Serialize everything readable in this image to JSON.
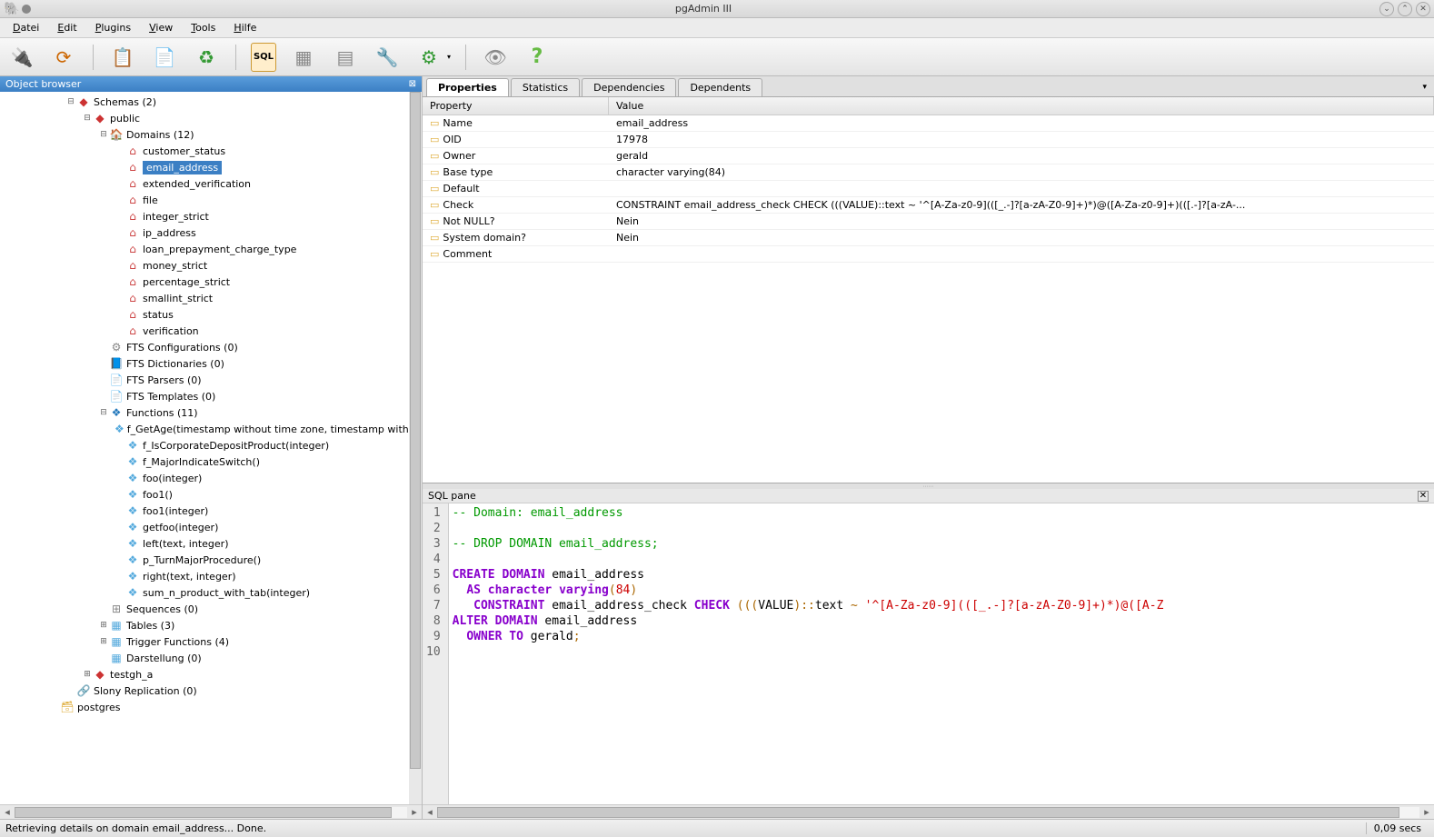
{
  "window": {
    "title": "pgAdmin III"
  },
  "menubar": [
    {
      "label": "Datei",
      "u": "D"
    },
    {
      "label": "Edit",
      "u": "E"
    },
    {
      "label": "Plugins",
      "u": "P"
    },
    {
      "label": "View",
      "u": "V"
    },
    {
      "label": "Tools",
      "u": "T"
    },
    {
      "label": "Hilfe",
      "u": "H"
    }
  ],
  "object_browser": {
    "title": "Object browser"
  },
  "tree": [
    {
      "depth": 4,
      "exp": "minus",
      "icon": "schema",
      "label": "Schemas (2)"
    },
    {
      "depth": 5,
      "exp": "minus",
      "icon": "public",
      "label": "public"
    },
    {
      "depth": 6,
      "exp": "minus",
      "icon": "domains",
      "label": "Domains (12)"
    },
    {
      "depth": 7,
      "exp": "",
      "icon": "domain",
      "label": "customer_status"
    },
    {
      "depth": 7,
      "exp": "",
      "icon": "domain",
      "label": "email_address",
      "selected": true
    },
    {
      "depth": 7,
      "exp": "",
      "icon": "domain",
      "label": "extended_verification"
    },
    {
      "depth": 7,
      "exp": "",
      "icon": "domain",
      "label": "file"
    },
    {
      "depth": 7,
      "exp": "",
      "icon": "domain",
      "label": "integer_strict"
    },
    {
      "depth": 7,
      "exp": "",
      "icon": "domain",
      "label": "ip_address"
    },
    {
      "depth": 7,
      "exp": "",
      "icon": "domain",
      "label": "loan_prepayment_charge_type"
    },
    {
      "depth": 7,
      "exp": "",
      "icon": "domain",
      "label": "money_strict"
    },
    {
      "depth": 7,
      "exp": "",
      "icon": "domain",
      "label": "percentage_strict"
    },
    {
      "depth": 7,
      "exp": "",
      "icon": "domain",
      "label": "smallint_strict"
    },
    {
      "depth": 7,
      "exp": "",
      "icon": "domain",
      "label": "status"
    },
    {
      "depth": 7,
      "exp": "",
      "icon": "domain",
      "label": "verification"
    },
    {
      "depth": 6,
      "exp": "",
      "icon": "fts",
      "label": "FTS Configurations (0)"
    },
    {
      "depth": 6,
      "exp": "",
      "icon": "dict",
      "label": "FTS Dictionaries (0)"
    },
    {
      "depth": 6,
      "exp": "",
      "icon": "parser",
      "label": "FTS Parsers (0)"
    },
    {
      "depth": 6,
      "exp": "",
      "icon": "template",
      "label": "FTS Templates (0)"
    },
    {
      "depth": 6,
      "exp": "minus",
      "icon": "func",
      "label": "Functions (11)"
    },
    {
      "depth": 7,
      "exp": "",
      "icon": "funcitem",
      "label": "f_GetAge(timestamp without time zone, timestamp without"
    },
    {
      "depth": 7,
      "exp": "",
      "icon": "funcitem",
      "label": "f_IsCorporateDepositProduct(integer)"
    },
    {
      "depth": 7,
      "exp": "",
      "icon": "funcitem",
      "label": "f_MajorIndicateSwitch()"
    },
    {
      "depth": 7,
      "exp": "",
      "icon": "funcitem",
      "label": "foo(integer)"
    },
    {
      "depth": 7,
      "exp": "",
      "icon": "funcitem",
      "label": "foo1()"
    },
    {
      "depth": 7,
      "exp": "",
      "icon": "funcitem",
      "label": "foo1(integer)"
    },
    {
      "depth": 7,
      "exp": "",
      "icon": "funcitem",
      "label": "getfoo(integer)"
    },
    {
      "depth": 7,
      "exp": "",
      "icon": "funcitem",
      "label": "left(text, integer)"
    },
    {
      "depth": 7,
      "exp": "",
      "icon": "funcitem",
      "label": "p_TurnMajorProcedure()"
    },
    {
      "depth": 7,
      "exp": "",
      "icon": "funcitem",
      "label": "right(text, integer)"
    },
    {
      "depth": 7,
      "exp": "",
      "icon": "funcitem",
      "label": "sum_n_product_with_tab(integer)"
    },
    {
      "depth": 6,
      "exp": "",
      "icon": "seq",
      "label": "Sequences (0)"
    },
    {
      "depth": 6,
      "exp": "plus",
      "icon": "table",
      "label": "Tables (3)"
    },
    {
      "depth": 6,
      "exp": "plus",
      "icon": "trigger",
      "label": "Trigger Functions (4)"
    },
    {
      "depth": 6,
      "exp": "",
      "icon": "darst",
      "label": "Darstellung (0)"
    },
    {
      "depth": 5,
      "exp": "plus",
      "icon": "testgh",
      "label": "testgh_a"
    },
    {
      "depth": 4,
      "exp": "",
      "icon": "slony",
      "label": "Slony Replication (0)"
    },
    {
      "depth": 3,
      "exp": "",
      "icon": "db",
      "label": "postgres"
    }
  ],
  "tabs": [
    {
      "label": "Properties",
      "active": true
    },
    {
      "label": "Statistics",
      "active": false
    },
    {
      "label": "Dependencies",
      "active": false
    },
    {
      "label": "Dependents",
      "active": false
    }
  ],
  "prop_header": {
    "col1": "Property",
    "col2": "Value"
  },
  "properties": [
    {
      "k": "Name",
      "v": "email_address"
    },
    {
      "k": "OID",
      "v": "17978"
    },
    {
      "k": "Owner",
      "v": "gerald"
    },
    {
      "k": "Base type",
      "v": "character varying(84)"
    },
    {
      "k": "Default",
      "v": ""
    },
    {
      "k": "Check",
      "v": "CONSTRAINT email_address_check CHECK (((VALUE)::text ~ '^[A-Za-z0-9](([_.-]?[a-zA-Z0-9]+)*)@([A-Za-z0-9]+)(([.-]?[a-zA-..."
    },
    {
      "k": "Not NULL?",
      "v": "Nein"
    },
    {
      "k": "System domain?",
      "v": "Nein"
    },
    {
      "k": "Comment",
      "v": ""
    }
  ],
  "sql_pane": {
    "title": "SQL pane"
  },
  "sql_lines": [
    {
      "n": 1,
      "html": "<span class='c-comment'>-- Domain: email_address</span>"
    },
    {
      "n": 2,
      "html": ""
    },
    {
      "n": 3,
      "html": "<span class='c-comment'>-- DROP DOMAIN email_address;</span>"
    },
    {
      "n": 4,
      "html": ""
    },
    {
      "n": 5,
      "html": "<span class='c-keyword'>CREATE</span> <span class='c-keyword'>DOMAIN</span> email_address"
    },
    {
      "n": 6,
      "html": "  <span class='c-keyword'>AS</span> <span class='c-keyword'>character varying</span><span class='c-op'>(</span><span class='c-num'>84</span><span class='c-op'>)</span>"
    },
    {
      "n": 7,
      "html": "   <span class='c-keyword'>CONSTRAINT</span> email_address_check <span class='c-keyword'>CHECK</span> <span class='c-op'>(((</span>VALUE<span class='c-op'>)::</span>text <span class='c-op'>~</span> <span class='c-str'>'^[A-Za-z0-9](([_.-]?[a-zA-Z0-9]+)*)@([A-Z</span>"
    },
    {
      "n": 8,
      "html": "<span class='c-keyword'>ALTER</span> <span class='c-keyword'>DOMAIN</span> email_address"
    },
    {
      "n": 9,
      "html": "  <span class='c-keyword'>OWNER TO</span> gerald<span class='c-op'>;</span>"
    },
    {
      "n": 10,
      "html": ""
    }
  ],
  "status": {
    "msg": "Retrieving details on domain email_address... Done.",
    "time": "0,09 secs"
  }
}
